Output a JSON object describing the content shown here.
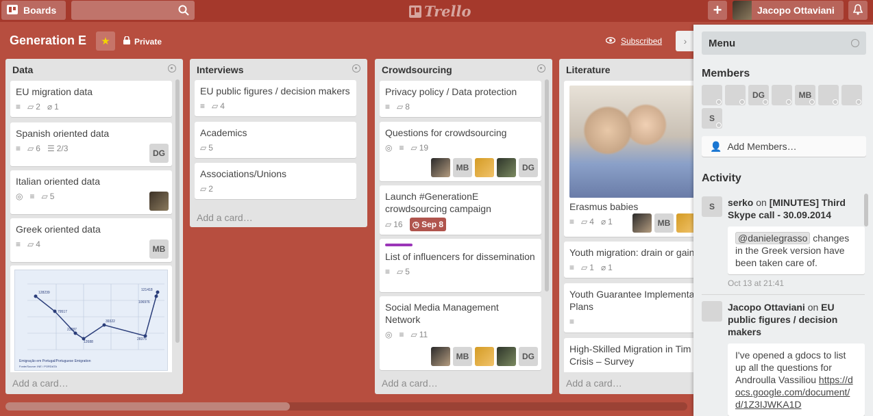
{
  "topbar": {
    "boards_label": "Boards",
    "logo_text": "Trello",
    "user_name": "Jacopo Ottaviani"
  },
  "board": {
    "title": "Generation E",
    "visibility": "Private",
    "subscribed_label": "Subscribed"
  },
  "lists": [
    {
      "name": "Data",
      "add_card": "Add a card…",
      "cards": [
        {
          "title": "EU migration data",
          "comments": "2",
          "attachments": "1"
        },
        {
          "title": "Spanish oriented data",
          "comments": "6",
          "checklist": "2/3",
          "member": "DG"
        },
        {
          "title": "Italian oriented data",
          "comments": "5"
        },
        {
          "title": "Greek oriented data",
          "comments": "4",
          "member": "MB"
        }
      ]
    },
    {
      "name": "Interviews",
      "add_card": "Add a card…",
      "cards": [
        {
          "title": "EU public figures / decision makers",
          "comments": "4"
        },
        {
          "title": "Academics",
          "comments": "5"
        },
        {
          "title": "Associations/Unions",
          "comments": "2"
        }
      ]
    },
    {
      "name": "Crowdsourcing",
      "add_card": "Add a card…",
      "cards": [
        {
          "title": "Privacy policy / Data protection",
          "comments": "8"
        },
        {
          "title": "Questions for crowdsourcing",
          "comments": "19",
          "members": [
            "MB",
            "DG"
          ]
        },
        {
          "title": "Launch #GenerationE crowdsourcing campaign",
          "comments": "16",
          "due": "Sep 8"
        },
        {
          "title": "List of influencers for dissemination",
          "comments": "5",
          "label_color": "#9b35b8"
        },
        {
          "title": "Social Media Management Network",
          "comments": "11",
          "members": [
            "MB",
            "DG"
          ]
        }
      ]
    },
    {
      "name": "Literature",
      "add_card": "Add a card…",
      "cards": [
        {
          "title": "Erasmus babies",
          "comments": "4",
          "attachments": "1",
          "members": [
            "MB"
          ]
        },
        {
          "title": "Youth migration: drain or gain",
          "comments": "1",
          "attachments": "1"
        },
        {
          "title": "Youth Guarantee Implementa Plans"
        },
        {
          "title": "High-Skilled Migration in Tim Crisis – Survey"
        }
      ]
    }
  ],
  "menu": {
    "title": "Menu",
    "members_heading": "Members",
    "members": [
      "DG",
      "MB",
      "S"
    ],
    "add_members": "Add Members…",
    "activity_heading": "Activity",
    "activity": [
      {
        "avatar": "S",
        "user": "serko",
        "verb": "on",
        "target": "[MINUTES] Third Skype call - 30.09.2014",
        "mention": "@danielegrasso",
        "comment": "changes in the Greek version have been taken care of.",
        "time": "Oct 13 at 21:41"
      },
      {
        "user": "Jacopo Ottaviani",
        "verb": "on",
        "target": "EU public figures / decision makers",
        "comment": "I've opened a gdocs to list up all the questions for Androulla Vassiliou",
        "link": "https://docs.google.com/document/d/1Z3IJWKA1D"
      }
    ]
  },
  "chart_thumbnail": {
    "labels": [
      "128239",
      "79517",
      "23287",
      "12688",
      "39322",
      "28375",
      "121418",
      "106976"
    ],
    "caption": "Emigração em Portugal/Portuguese Emigration",
    "source": "Fonte/Source: INE / PORDATA"
  },
  "colors": {
    "board_bg": "#b74e3f",
    "topbar": "#a5392c",
    "label_purple": "#9b35b8",
    "due_badge": "#b0544d"
  }
}
